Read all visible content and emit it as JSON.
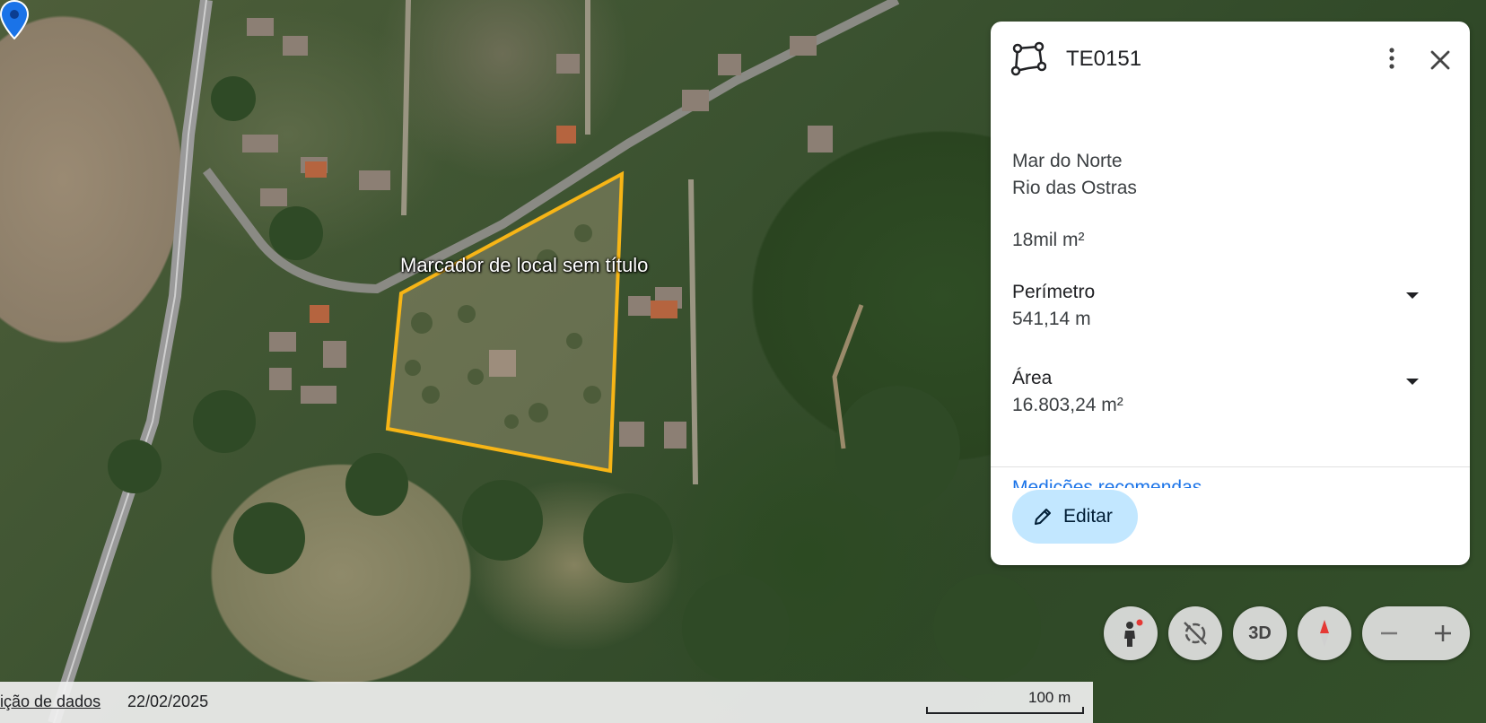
{
  "map": {
    "marker_label": "Marcador de local sem título"
  },
  "panel": {
    "title": "TE0151",
    "address_line1": "Mar do Norte",
    "address_line2": "Rio das Ostras",
    "area_summary": "18mil m²",
    "perimeter_title": "Perímetro",
    "perimeter_value": "541,14 m",
    "area_title": "Área",
    "area_value": "16.803,24 m²",
    "partial_link": "Medições recomendas",
    "edit_label": "Editar"
  },
  "controls": {
    "three_d_label": "3D"
  },
  "footer": {
    "data_link": "ição de dados",
    "date": "22/02/2025",
    "scale": "100 m"
  },
  "colors": {
    "polygon": "#f7b516",
    "pin": "#1a73e8",
    "edit_button": "#c2e7ff",
    "compass_north": "#e53935"
  },
  "icons": [
    "polygon-shape-icon",
    "more-vert-icon",
    "close-icon",
    "arrow-drop-down-icon",
    "pencil-icon",
    "pegman-icon",
    "tilt-off-icon",
    "compass-icon",
    "zoom-out-icon",
    "zoom-in-icon",
    "location-pin-icon"
  ]
}
